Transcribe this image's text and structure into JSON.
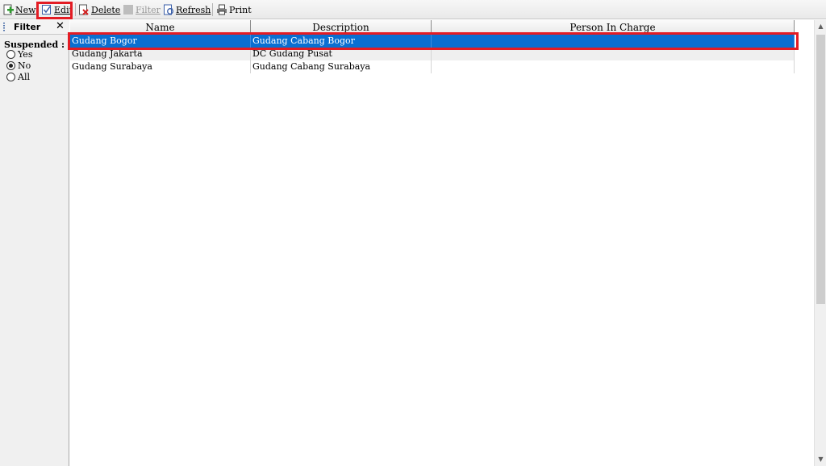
{
  "toolbar": {
    "new_label": "New",
    "edit_label": "Edit",
    "delete_label": "Delete",
    "filter_label": "Filter",
    "refresh_label": "Refresh",
    "print_label": "Print"
  },
  "filter_panel": {
    "title": "Filter",
    "close_glyph": "✕",
    "suspended_label": "Suspended :",
    "options": [
      {
        "label": "Yes",
        "checked": false
      },
      {
        "label": "No",
        "checked": true
      },
      {
        "label": "All",
        "checked": false
      }
    ]
  },
  "grid": {
    "columns": [
      "Name",
      "Description",
      "Person In Charge"
    ],
    "rows": [
      {
        "name": "Gudang Bogor",
        "description": "Gudang Cabang Bogor",
        "person": "",
        "selected": true
      },
      {
        "name": "Gudang Jakarta",
        "description": "DC Gudang Pusat",
        "person": "",
        "selected": false
      },
      {
        "name": "Gudang Surabaya",
        "description": "Gudang Cabang Surabaya",
        "person": "",
        "selected": false
      }
    ]
  },
  "colors": {
    "selection": "#0a6fd1",
    "highlight": "#e31c24"
  }
}
